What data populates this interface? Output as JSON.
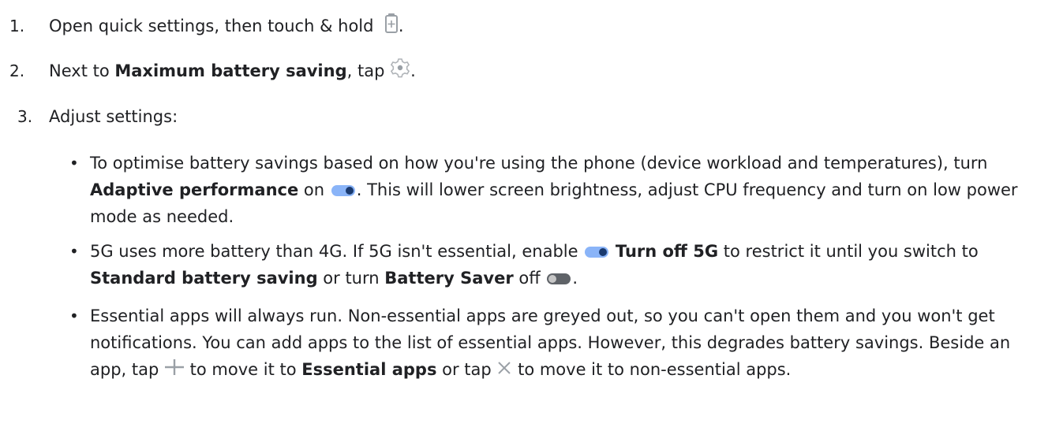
{
  "steps": [
    {
      "number": "1.",
      "t1": "Open quick settings, then touch & hold",
      "t2": "."
    },
    {
      "number": "2.",
      "t1": "Next to ",
      "b1": "Maximum battery saving",
      "t2": ", tap ",
      "t3": "."
    },
    {
      "number": "3.",
      "t1": "Adjust settings:"
    }
  ],
  "bullets": [
    {
      "t1": "To optimise battery savings based on how you're using the phone (device workload and temperatures), turn ",
      "b1": "Adaptive performance",
      "t2": " on ",
      "t3": ". This will lower screen brightness, adjust CPU frequency and turn on low power mode as needed."
    },
    {
      "t1": "5G uses more battery than 4G. If 5G isn't essential, enable ",
      "b1": "Turn off 5G",
      "t2": " to restrict it until you switch to ",
      "b2": "Standard battery saving",
      "t3": " or turn ",
      "b3": "Battery Saver",
      "t4": " off ",
      "t5": "."
    },
    {
      "t1": "Essential apps will always run. Non-essential apps are greyed out, so you can't open them and you won't get notifications. You can add apps to the list of essential apps. However, this degrades battery savings. Beside an app, tap ",
      "t2": " to move it to ",
      "b1": "Essential apps",
      "t3": " or tap ",
      "t4": " to move it to non-essential apps."
    }
  ],
  "bullet_symbol": "•",
  "icons": [
    "battery-saver-icon",
    "settings-gear-icon",
    "toggle-on-icon",
    "toggle-off-icon",
    "plus-icon",
    "close-icon"
  ],
  "colors": {
    "text": "#202124",
    "toggle_on_track": "#8ab4f8",
    "toggle_on_thumb": "#1a3a6e",
    "toggle_off_track": "#5f6368",
    "icon_grey": "#9aa0a6"
  }
}
